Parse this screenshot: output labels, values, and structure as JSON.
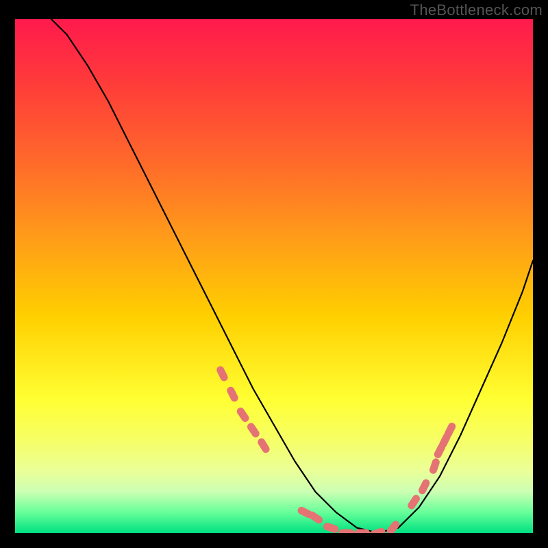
{
  "attribution": "TheBottleneck.com",
  "chart_data": {
    "type": "line",
    "title": "",
    "xlabel": "",
    "ylabel": "",
    "xlim": [
      0,
      100
    ],
    "ylim": [
      0,
      100
    ],
    "grid": false,
    "legend": false,
    "gradient_stops": [
      {
        "pos": 0,
        "color": "#ff1a4d"
      },
      {
        "pos": 12,
        "color": "#ff3a3a"
      },
      {
        "pos": 28,
        "color": "#ff6a2a"
      },
      {
        "pos": 42,
        "color": "#ff9a1a"
      },
      {
        "pos": 58,
        "color": "#ffd000"
      },
      {
        "pos": 74,
        "color": "#ffff33"
      },
      {
        "pos": 82,
        "color": "#f6ff66"
      },
      {
        "pos": 88,
        "color": "#eaff99"
      },
      {
        "pos": 92,
        "color": "#ccffb3"
      },
      {
        "pos": 96,
        "color": "#66ff99"
      },
      {
        "pos": 100,
        "color": "#00e080"
      }
    ],
    "series": [
      {
        "name": "bottleneck-curve",
        "color": "#000000",
        "x": [
          7,
          10,
          14,
          18,
          22,
          26,
          30,
          34,
          38,
          42,
          46,
          50,
          54,
          58,
          62,
          66,
          70,
          74,
          78,
          82,
          86,
          90,
          94,
          98,
          100
        ],
        "y": [
          100,
          97,
          91,
          84,
          76,
          68,
          60,
          52,
          44,
          36,
          28,
          21,
          14,
          8,
          4,
          1,
          0,
          1,
          5,
          11,
          19,
          28,
          37,
          47,
          53
        ]
      }
    ],
    "highlight_points": {
      "name": "optimal-range",
      "color": "#e57373",
      "points": [
        {
          "x": 40,
          "y": 31
        },
        {
          "x": 42,
          "y": 27
        },
        {
          "x": 44,
          "y": 23
        },
        {
          "x": 46,
          "y": 20
        },
        {
          "x": 48,
          "y": 17
        },
        {
          "x": 56,
          "y": 4
        },
        {
          "x": 58,
          "y": 3
        },
        {
          "x": 61,
          "y": 1
        },
        {
          "x": 64,
          "y": 0
        },
        {
          "x": 67,
          "y": 0
        },
        {
          "x": 70,
          "y": 0
        },
        {
          "x": 73,
          "y": 1
        },
        {
          "x": 77,
          "y": 6
        },
        {
          "x": 79,
          "y": 9
        },
        {
          "x": 81,
          "y": 13
        },
        {
          "x": 82,
          "y": 16
        },
        {
          "x": 83,
          "y": 18
        },
        {
          "x": 84,
          "y": 20
        }
      ]
    }
  }
}
